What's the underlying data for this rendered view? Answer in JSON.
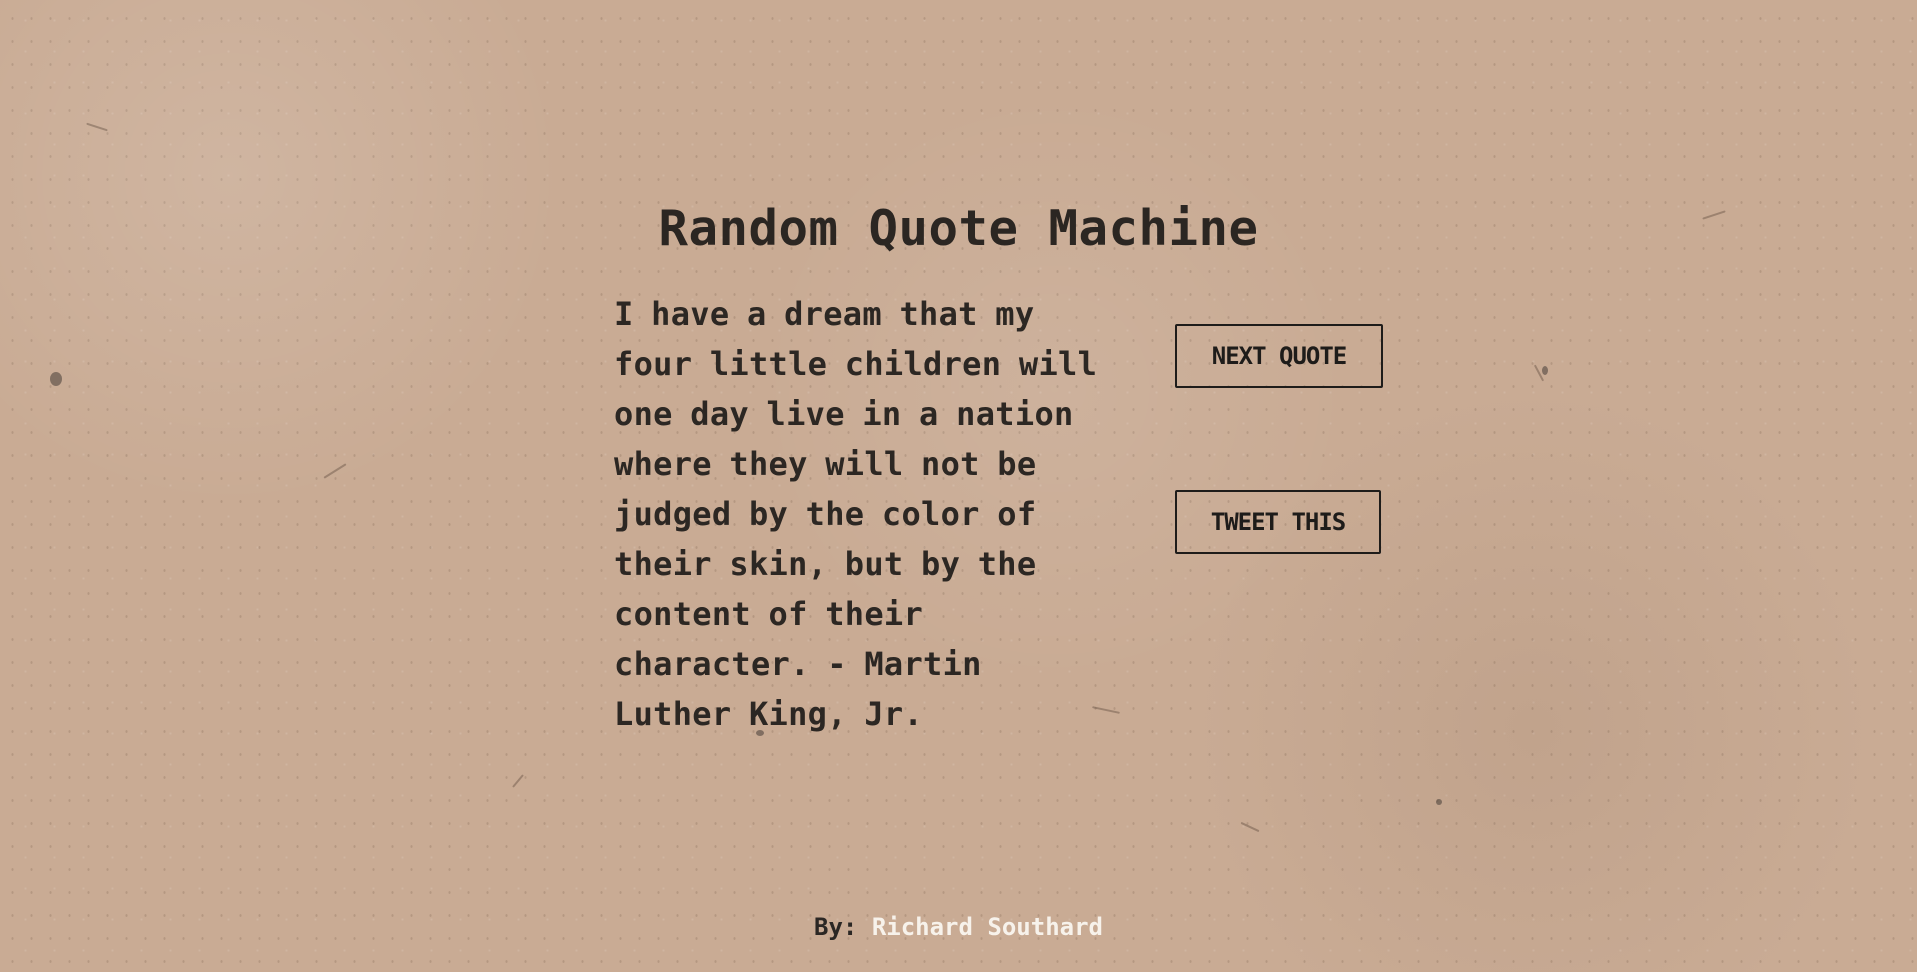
{
  "app": {
    "title": "Random Quote Machine"
  },
  "quote": {
    "text": "I have a dream that my four little children will one day live in a nation where they will not be judged by the color of their skin, but by the content of their character. - Martin Luther King, Jr."
  },
  "actions": {
    "next_quote_label": "NEXT QUOTE",
    "tweet_label": "TWEET THIS"
  },
  "footer": {
    "prefix": "By:",
    "author_link": "Richard Southard"
  },
  "theme": {
    "background": "#c9ab94",
    "text": "#2b2724",
    "link": "#f7f2eb",
    "button_border": "#1e1c1a"
  }
}
